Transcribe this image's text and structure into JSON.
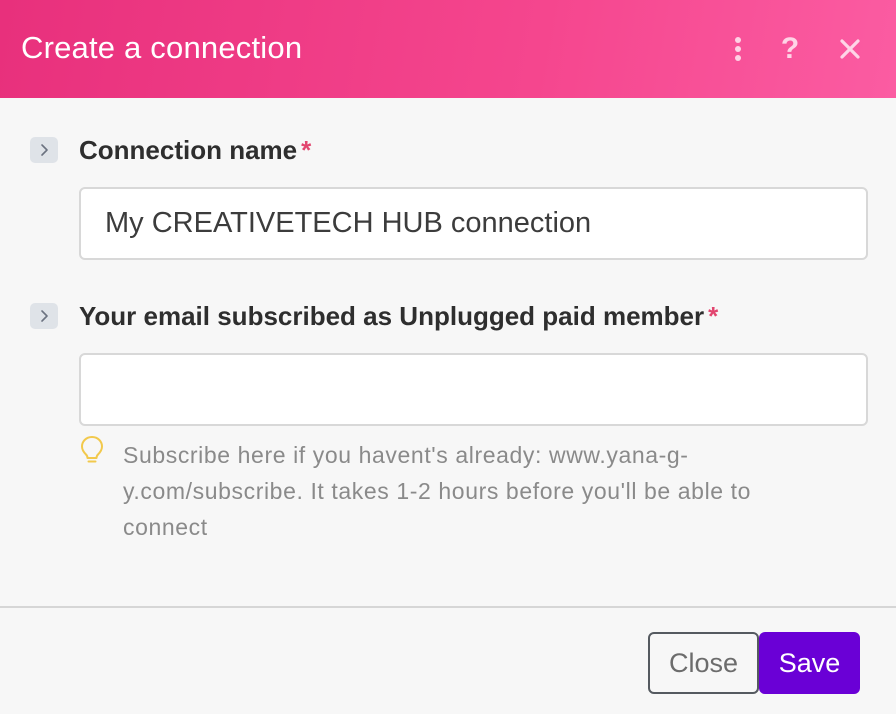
{
  "dialog": {
    "title": "Create a connection",
    "header_icons": [
      "more-vertical-icon",
      "help-icon",
      "close-icon"
    ],
    "header_help_glyph": "?",
    "accent_color": "#f5468e",
    "required_color": "#e2456f"
  },
  "fields": [
    {
      "label": "Connection name",
      "required_mark": "*",
      "value": "My CREATIVETECH HUB connection",
      "placeholder": ""
    },
    {
      "label": "Your email subscribed as Unplugged paid member",
      "required_mark": "*",
      "value": "",
      "placeholder": "",
      "hint": "Subscribe here if you havent's already: www.yana-g-y.com/subscribe. It takes 1-2 hours before you'll be able to connect",
      "hint_icon": "lightbulb-icon"
    }
  ],
  "footer": {
    "close_label": "Close",
    "save_label": "Save",
    "save_color": "#6a00d6"
  }
}
